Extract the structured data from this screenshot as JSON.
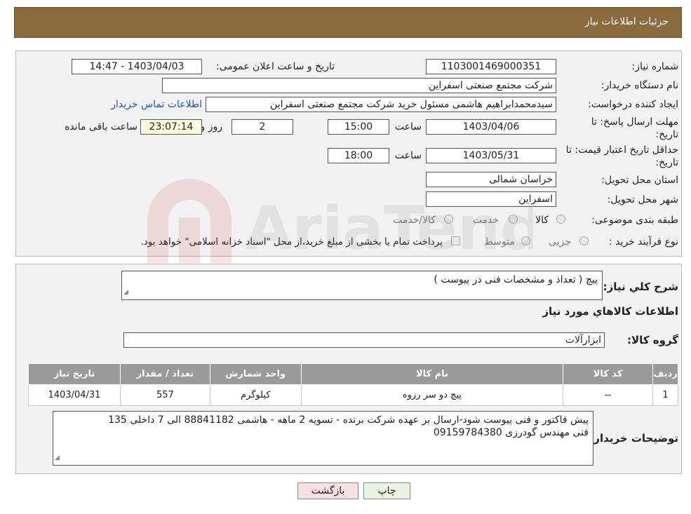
{
  "header": {
    "title": "جزئیات اطلاعات نیاز"
  },
  "form": {
    "need_number_label": "شماره نیاز:",
    "need_number": "1103001469000351",
    "announce_label": "تاریخ و ساعت اعلان عمومی:",
    "announce_value": "1403/04/03 - 14:47",
    "buyer_org_label": "نام دستگاه خریدار:",
    "buyer_org": "شرکت مجتمع صنعتی اسفراین",
    "creator_label": "ایجاد کننده درخواست:",
    "creator": "سیدمحمدابراهیم هاشمی مسئول خرید شرکت مجتمع صنعتی اسفراین",
    "contact_link": "اطلاعات تماس خریدار",
    "reply_deadline_label_1": "مهلت ارسال پاسخ: تا",
    "reply_deadline_label_2": "تاریخ:",
    "reply_date": "1403/04/06",
    "time_label": "ساعت",
    "reply_time": "15:00",
    "days_value": "2",
    "days_label": "روز و",
    "remaining_time": "23:07:14",
    "remaining_label": "ساعت باقی مانده",
    "price_valid_label_1": "حداقل تاریخ اعتبار قیمت: تا",
    "price_valid_label_2": "تاریخ:",
    "price_valid_date": "1403/05/31",
    "price_valid_time": "18:00",
    "province_label": "استان محل تحویل:",
    "province": "خراسان شمالی",
    "city_label": "شهر محل تحویل:",
    "city": "اسفراین",
    "category_label": "طبقه بندی موضوعی:",
    "category_options": [
      "کالا",
      "خدمت",
      "کالا/خدمت"
    ],
    "process_label": "نوع فرآیند خرید :",
    "process_options": [
      "جزیی",
      "متوسط"
    ],
    "process_note": "پرداخت تمام یا بخشی از مبلغ خرید،از محل \"اسناد خزانه اسلامی\" خواهد بود."
  },
  "details": {
    "summary_label": "شرح کلي نياز:",
    "summary": "پیچ ( تعداد و مشخصات فنی در پیوست )",
    "items_title": "اطلاعات کالاهاي مورد نياز",
    "group_label": "گروه کالا:",
    "group_value": "ابزارآلات",
    "table": {
      "headers": [
        "ردیف",
        "کد کالا",
        "نام کالا",
        "واحد شمارش",
        "تعداد / مقدار",
        "تاریخ نیاز"
      ],
      "rows": [
        [
          "1",
          "--",
          "پیچ دو سر رزوه",
          "کیلوگرم",
          "557",
          "1403/04/31"
        ]
      ]
    },
    "buyer_notes_label": "توضیحات خریدار:",
    "buyer_notes_line1": "پیش فاکتور و فنی پیوست شود-ارسال بر عهده شرکت برنده - تسویه 2 ماهه - هاشمی 88841182 الی 7 داخلی 135",
    "buyer_notes_line2": "فنی مهندس گودرزی 09159784380"
  },
  "buttons": {
    "print": "چاپ",
    "back": "بازگشت"
  },
  "watermark": "AriaTender.neT"
}
